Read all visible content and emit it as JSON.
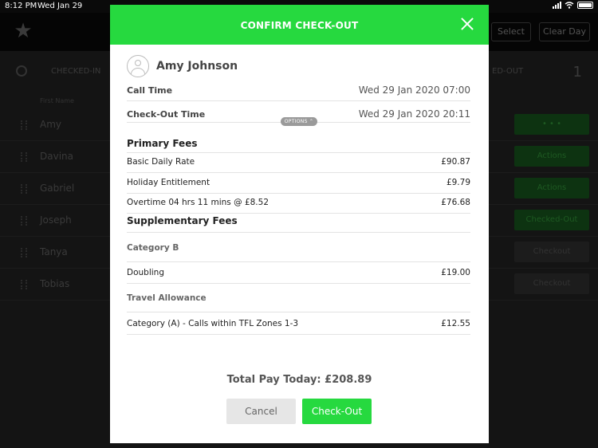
{
  "status_bar": {
    "time": "8:12 PM",
    "date": "Wed Jan 29"
  },
  "background": {
    "select_button": "Select",
    "clear_day_button": "Clear Day",
    "tabs": [
      "CHECKED-IN",
      "ED-OUT"
    ],
    "count": "1",
    "column_header": "First Name",
    "rows": [
      {
        "name": "Amy",
        "action": "• • •"
      },
      {
        "name": "Davina",
        "action": "Actions"
      },
      {
        "name": "Gabriel",
        "action": "Actions"
      },
      {
        "name": "Joseph",
        "action": "Checked-Out"
      },
      {
        "name": "Tanya",
        "action": "Checkout"
      },
      {
        "name": "Tobias",
        "action": "Checkout"
      }
    ]
  },
  "modal": {
    "title": "CONFIRM CHECK-OUT",
    "person_name": "Amy Johnson",
    "call_time": {
      "label": "Call Time",
      "value": "Wed 29 Jan 2020 07:00"
    },
    "checkout_time": {
      "label": "Check-Out Time",
      "value": "Wed 29 Jan 2020 20:11"
    },
    "options_label": "OPTIONS ⌃",
    "primary_fees": {
      "heading": "Primary Fees",
      "items": [
        {
          "label": "Basic Daily Rate",
          "amount": "£90.87"
        },
        {
          "label": "Holiday Entitlement",
          "amount": "£9.79"
        },
        {
          "label": "Overtime 04 hrs 11 mins @ £8.52",
          "amount": "£76.68"
        }
      ]
    },
    "supplementary_fees": {
      "heading": "Supplementary Fees",
      "categories": [
        {
          "name": "Category B",
          "items": [
            {
              "label": "Doubling",
              "amount": "£19.00"
            }
          ]
        },
        {
          "name": "Travel Allowance",
          "items": [
            {
              "label": "Category (A) - Calls within TFL Zones 1-3",
              "amount": "£12.55"
            }
          ]
        }
      ]
    },
    "total": "Total Pay Today:  £208.89",
    "cancel_label": "Cancel",
    "checkout_label": "Check-Out"
  }
}
